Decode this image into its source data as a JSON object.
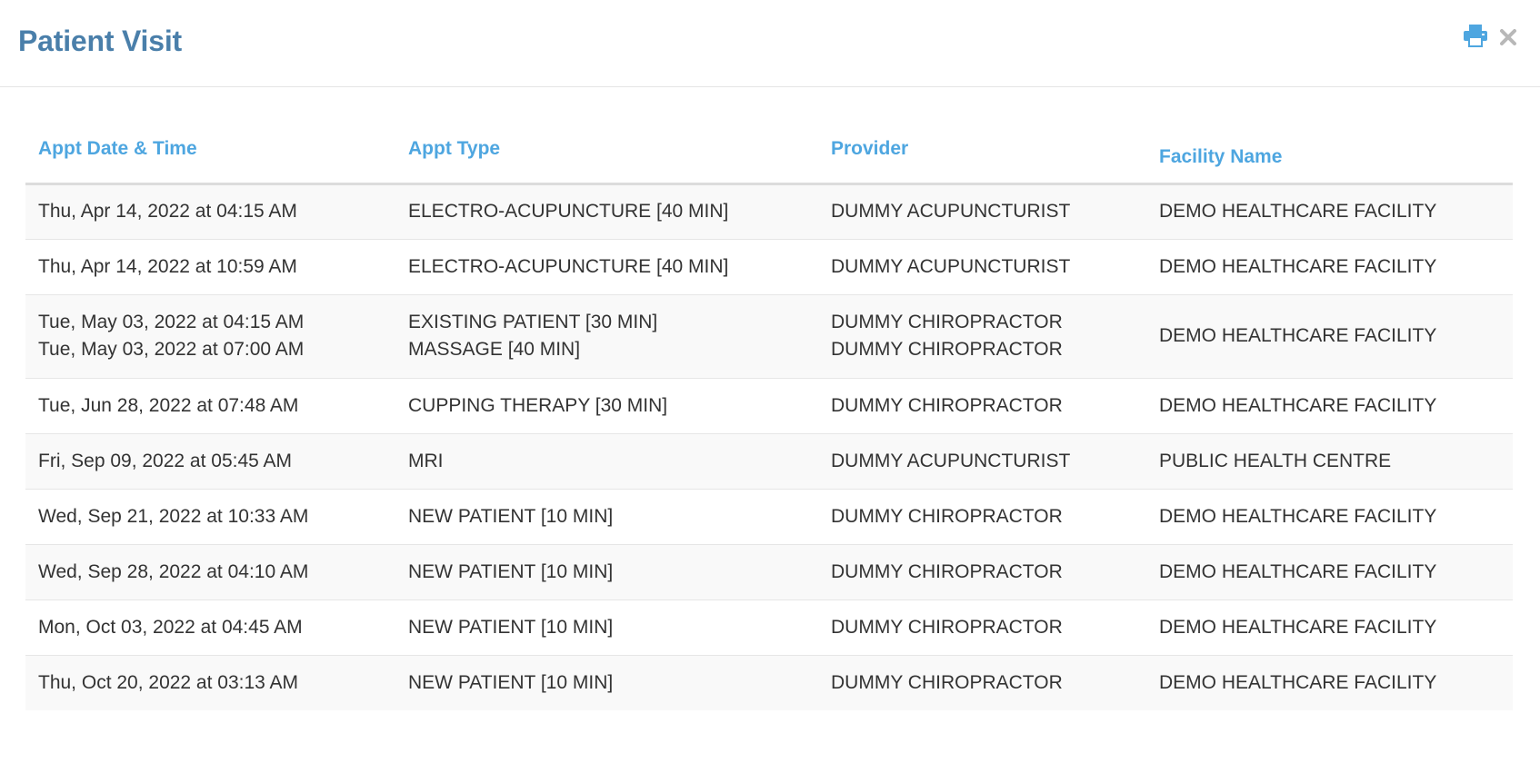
{
  "modal": {
    "title": "Patient Visit",
    "colors": {
      "title": "#4a7faa",
      "header_text": "#4ea6e0",
      "print_icon": "#4ea6e0",
      "close_icon": "#b8b8b8"
    },
    "icons": {
      "print": "printer-icon",
      "close": "close-icon"
    }
  },
  "table": {
    "headers": {
      "date": "Appt Date & Time",
      "type": "Appt Type",
      "provider": "Provider",
      "facility": "Facility Name"
    },
    "rows": [
      {
        "dates": [
          "Thu, Apr 14, 2022 at 04:15 AM"
        ],
        "types": [
          "ELECTRO-ACUPUNCTURE [40 MIN]"
        ],
        "providers": [
          "DUMMY ACUPUNCTURIST"
        ],
        "facility": "DEMO HEALTHCARE FACILITY"
      },
      {
        "dates": [
          "Thu, Apr 14, 2022 at 10:59 AM"
        ],
        "types": [
          "ELECTRO-ACUPUNCTURE [40 MIN]"
        ],
        "providers": [
          "DUMMY ACUPUNCTURIST"
        ],
        "facility": "DEMO HEALTHCARE FACILITY"
      },
      {
        "dates": [
          "Tue, May 03, 2022 at 04:15 AM",
          "Tue, May 03, 2022 at 07:00 AM"
        ],
        "types": [
          "EXISTING PATIENT [30 MIN]",
          "MASSAGE [40 MIN]"
        ],
        "providers": [
          "DUMMY CHIROPRACTOR",
          "DUMMY CHIROPRACTOR"
        ],
        "facility": "DEMO HEALTHCARE FACILITY"
      },
      {
        "dates": [
          "Tue, Jun 28, 2022 at 07:48 AM"
        ],
        "types": [
          "CUPPING THERAPY [30 MIN]"
        ],
        "providers": [
          "DUMMY CHIROPRACTOR"
        ],
        "facility": "DEMO HEALTHCARE FACILITY"
      },
      {
        "dates": [
          "Fri, Sep 09, 2022 at 05:45 AM"
        ],
        "types": [
          "MRI"
        ],
        "providers": [
          "DUMMY ACUPUNCTURIST"
        ],
        "facility": "PUBLIC HEALTH CENTRE"
      },
      {
        "dates": [
          "Wed, Sep 21, 2022 at 10:33 AM"
        ],
        "types": [
          "NEW PATIENT [10 MIN]"
        ],
        "providers": [
          "DUMMY CHIROPRACTOR"
        ],
        "facility": "DEMO HEALTHCARE FACILITY"
      },
      {
        "dates": [
          "Wed, Sep 28, 2022 at 04:10 AM"
        ],
        "types": [
          "NEW PATIENT [10 MIN]"
        ],
        "providers": [
          "DUMMY CHIROPRACTOR"
        ],
        "facility": "DEMO HEALTHCARE FACILITY"
      },
      {
        "dates": [
          "Mon, Oct 03, 2022 at 04:45 AM"
        ],
        "types": [
          "NEW PATIENT [10 MIN]"
        ],
        "providers": [
          "DUMMY CHIROPRACTOR"
        ],
        "facility": "DEMO HEALTHCARE FACILITY"
      },
      {
        "dates": [
          "Thu, Oct 20, 2022 at 03:13 AM"
        ],
        "types": [
          "NEW PATIENT [10 MIN]"
        ],
        "providers": [
          "DUMMY CHIROPRACTOR"
        ],
        "facility": "DEMO HEALTHCARE FACILITY"
      }
    ]
  }
}
